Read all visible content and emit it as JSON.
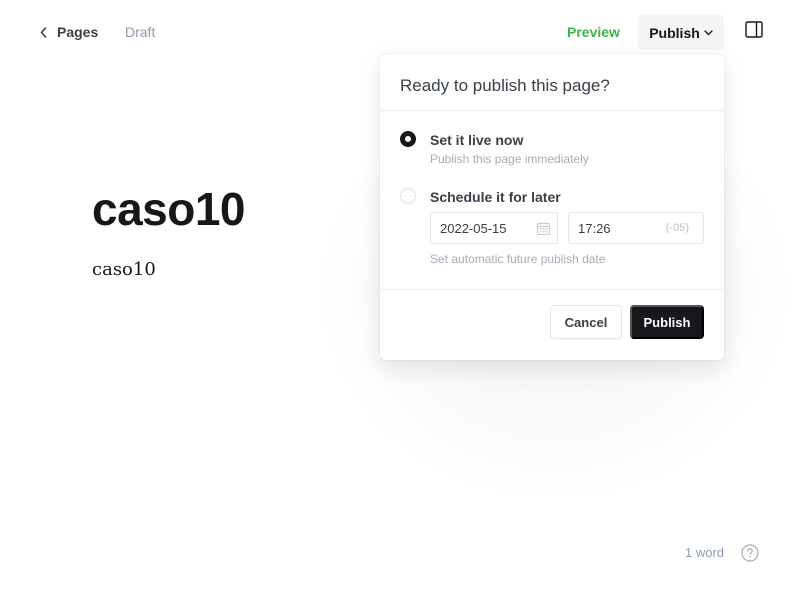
{
  "header": {
    "back_label": "Pages",
    "status": "Draft",
    "preview_label": "Preview",
    "publish_trigger_label": "Publish"
  },
  "editor": {
    "title": "caso10",
    "body": "caso10"
  },
  "publish_menu": {
    "heading": "Ready to publish this page?",
    "options": [
      {
        "title": "Set it live now",
        "description": "Publish this page immediately",
        "selected": true
      },
      {
        "title": "Schedule it for later",
        "description": "Set automatic future publish date",
        "selected": false
      }
    ],
    "schedule": {
      "date": "2022-05-15",
      "time": "17:26",
      "timezone": "(-05)"
    },
    "cancel_label": "Cancel",
    "publish_label": "Publish"
  },
  "footer": {
    "word_count": "1 word"
  },
  "colors": {
    "preview": "#3eb152",
    "primary_dark": "#15171a",
    "muted": "#8e9cac"
  },
  "icons": {
    "back": "chevron-left-icon",
    "dropdown": "chevron-down-icon",
    "sidebar": "sidebar-panel-icon",
    "calendar": "calendar-icon",
    "help": "question-circle-icon"
  }
}
